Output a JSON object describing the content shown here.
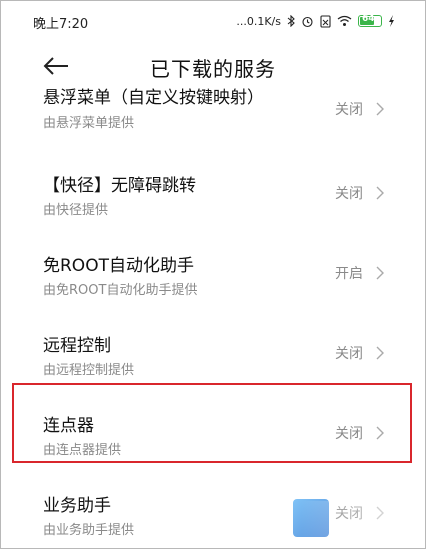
{
  "status_bar": {
    "time": "晚上7:20",
    "network_speed": "...0.1K/s",
    "battery_level": "64",
    "icons": [
      "bluetooth-icon",
      "alarm-icon",
      "sim-icon",
      "wifi-icon",
      "battery-icon",
      "charging-icon"
    ]
  },
  "header": {
    "title": "已下载的服务",
    "back_icon": "arrow-left-icon"
  },
  "services": [
    {
      "name": "悬浮菜单（自定义按键映射）",
      "provider": "由悬浮菜单提供",
      "status": "关闭"
    },
    {
      "name": "【快径】无障碍跳转",
      "provider": "由快径提供",
      "status": "关闭"
    },
    {
      "name": "免ROOT自动化助手",
      "provider": "由免ROOT自动化助手提供",
      "status": "开启"
    },
    {
      "name": "远程控制",
      "provider": "由远程控制提供",
      "status": "关闭"
    },
    {
      "name": "连点器",
      "provider": "由连点器提供",
      "status": "关闭"
    },
    {
      "name": "业务助手",
      "provider": "由业务助手提供",
      "status": "关闭"
    }
  ],
  "highlight": {
    "target": "连点器",
    "color": "#d9262c"
  },
  "colors": {
    "battery": "#3bb54a",
    "secondary_text": "#8a8a8a"
  }
}
